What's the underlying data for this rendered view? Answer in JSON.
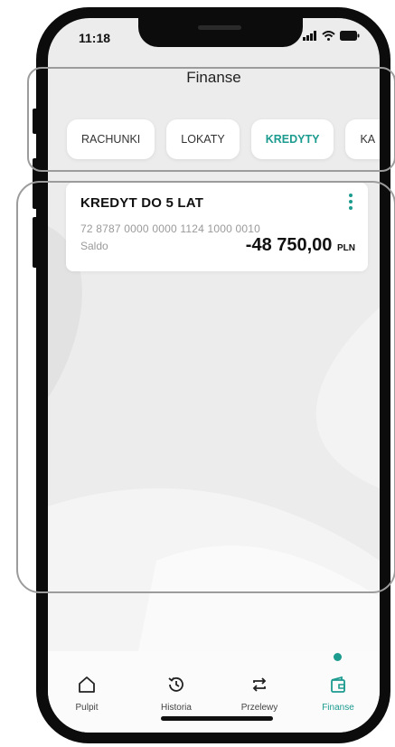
{
  "status_bar": {
    "time": "11:18"
  },
  "header": {
    "title": "Finanse"
  },
  "tabs": [
    {
      "label": "RACHUNKI",
      "active": false
    },
    {
      "label": "LOKATY",
      "active": false
    },
    {
      "label": "KREDYTY",
      "active": true
    },
    {
      "label": "KA",
      "active": false
    }
  ],
  "loan_card": {
    "title": "KREDYT DO 5 LAT",
    "account_number": "72 8787 0000 0000 1124 1000 0010",
    "balance_label": "Saldo",
    "balance_amount": "-48 750,00",
    "balance_currency": "PLN",
    "menu_icon": "more-vertical-icon"
  },
  "bottom_nav": [
    {
      "label": "Pulpit",
      "icon": "home-icon",
      "active": false
    },
    {
      "label": "Historia",
      "icon": "history-icon",
      "active": false
    },
    {
      "label": "Przelewy",
      "icon": "transfer-arrows-icon",
      "active": false
    },
    {
      "label": "Finanse",
      "icon": "wallet-icon",
      "active": true
    }
  ],
  "colors": {
    "accent": "#1c9b8f",
    "background": "#ececec",
    "card": "#ffffff"
  }
}
